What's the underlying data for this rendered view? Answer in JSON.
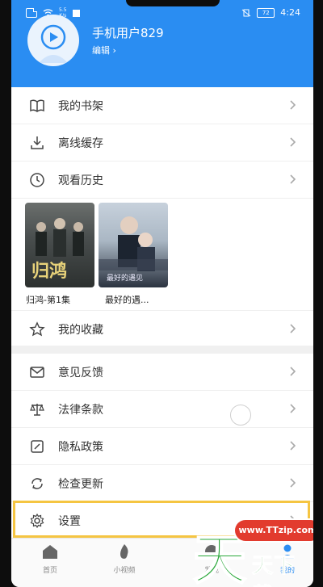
{
  "status_bar": {
    "speed_top": "5.5",
    "speed_bottom": "K/s",
    "battery": "72",
    "time": "4:24"
  },
  "profile": {
    "username": "手机用户829",
    "edit_label": "编辑 ›"
  },
  "menu_top": [
    {
      "label": "我的书架",
      "icon": "book-icon"
    },
    {
      "label": "离线缓存",
      "icon": "download-icon"
    },
    {
      "label": "观看历史",
      "icon": "clock-icon"
    }
  ],
  "history": [
    {
      "title": "归鸿-第1集"
    },
    {
      "title": "最好的遇..."
    }
  ],
  "favorites": {
    "label": "我的收藏",
    "icon": "star-icon"
  },
  "menu_bottom": [
    {
      "label": "意见反馈",
      "icon": "mail-icon"
    },
    {
      "label": "法律条款",
      "icon": "scale-icon"
    },
    {
      "label": "隐私政策",
      "icon": "edit-box-icon"
    },
    {
      "label": "检查更新",
      "icon": "refresh-icon"
    },
    {
      "label": "设置",
      "icon": "gear-icon"
    }
  ],
  "nav": [
    {
      "label": "首页",
      "icon": "home-icon"
    },
    {
      "label": "小视频",
      "icon": "flame-icon"
    },
    {
      "label": "发现",
      "icon": "compass-icon"
    },
    {
      "label": "我的",
      "icon": "user-icon"
    }
  ],
  "watermark": {
    "url": "www.TTzip.com",
    "big": "天",
    "small": "天下载"
  },
  "colors": {
    "primary": "#2a8df2",
    "highlight": "#f5c542",
    "watermark_green": "#2aa83a",
    "watermark_red": "#e23b2e"
  }
}
